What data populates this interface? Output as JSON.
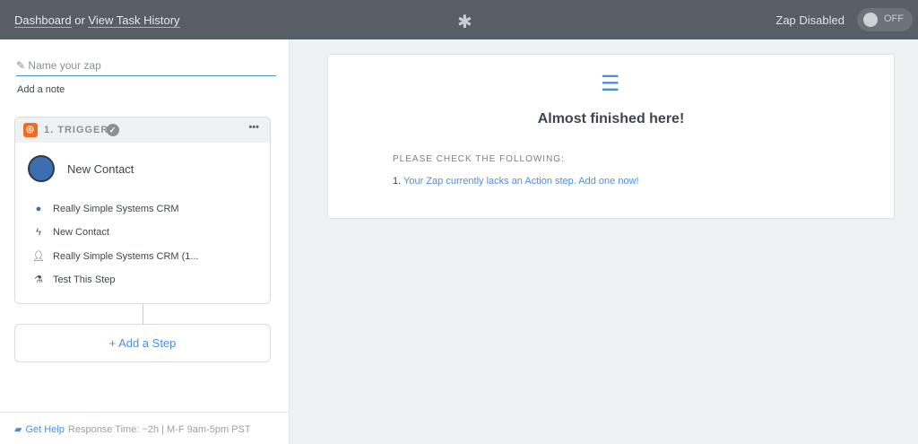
{
  "header": {
    "dashboard": "Dashboard",
    "or": "or",
    "task_history": "View Task History",
    "zap_status": "Zap Disabled",
    "toggle": "OFF"
  },
  "sidebar": {
    "name_placeholder": "Name your zap",
    "add_note": "Add a note",
    "trigger": {
      "label": "1. TRIGGER",
      "title": "New Contact",
      "rows": [
        {
          "icon": "app-icon",
          "text": "Really Simple Systems CRM"
        },
        {
          "icon": "bolt-icon",
          "text": "New Contact"
        },
        {
          "icon": "user-icon",
          "text": "Really Simple Systems CRM (1..."
        },
        {
          "icon": "flask-icon",
          "text": "Test This Step"
        }
      ]
    },
    "add_step": "+ Add a Step",
    "footer": {
      "get_help": "Get Help",
      "response": "Response Time: ~2h | M-F 9am-5pm PST"
    }
  },
  "panel": {
    "title": "Almost finished here!",
    "check_heading": "PLEASE CHECK THE FOLLOWING:",
    "item_num": "1.",
    "item_text": "Your Zap currently lacks an Action step. Add one now!"
  }
}
